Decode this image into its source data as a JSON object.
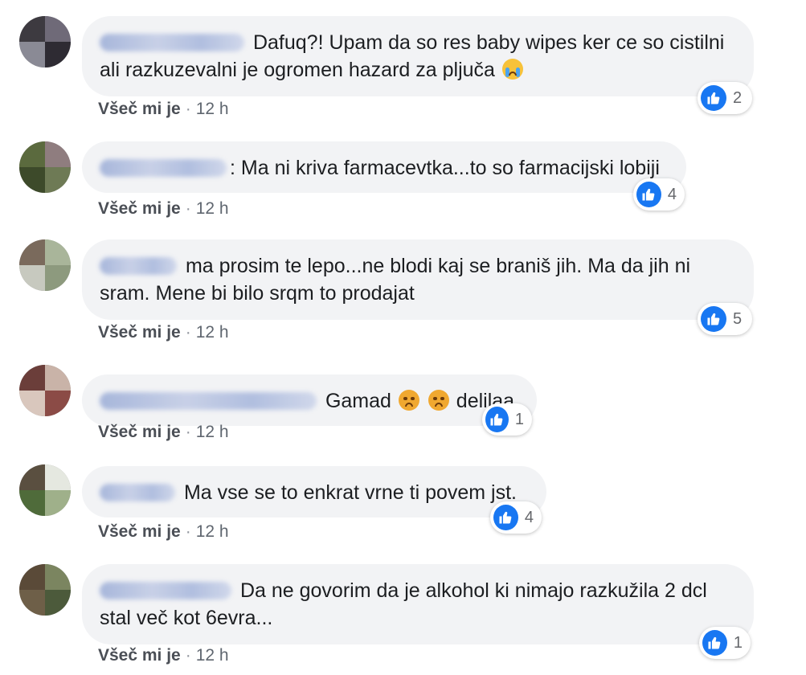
{
  "comments": [
    {
      "text": "Dafuq?! Upam da so res baby wipes ker ce so cistilni ali razkuzevalni je ogromen hazard za pljuča",
      "like_label": "Všeč mi je",
      "time": "12 h",
      "reactions": "2",
      "emoji": "crying-face-emoji"
    },
    {
      "text": ": Ma ni kriva farmacevtka...to so farmacijski lobiji",
      "like_label": "Všeč mi je",
      "time": "12 h",
      "reactions": "4"
    },
    {
      "text": "ma prosim te lepo...ne blodi kaj se braniš jih. Ma da jih ni sram. Mene bi bilo srqm to prodajat",
      "like_label": "Všeč mi je",
      "time": "12 h",
      "reactions": "5"
    },
    {
      "text_prefix": "Gamad ",
      "text_suffix": "delilaa",
      "like_label": "Všeč mi je",
      "time": "12 h",
      "reactions": "1",
      "emoji": "angry-face-emoji"
    },
    {
      "text": "Ma vse se to enkrat vrne ti povem jst.",
      "like_label": "Všeč mi je",
      "time": "12 h",
      "reactions": "4"
    },
    {
      "text": "Da ne govorim da je alkohol ki nimajo razkužila 2 dcl stal več kot 6evra...",
      "like_label": "Všeč mi je",
      "time": "12 h",
      "reactions": "1"
    }
  ],
  "separator": "·",
  "colors": {
    "bubble": "#f2f3f5",
    "like_blue": "#1877f2",
    "meta": "#606770"
  }
}
